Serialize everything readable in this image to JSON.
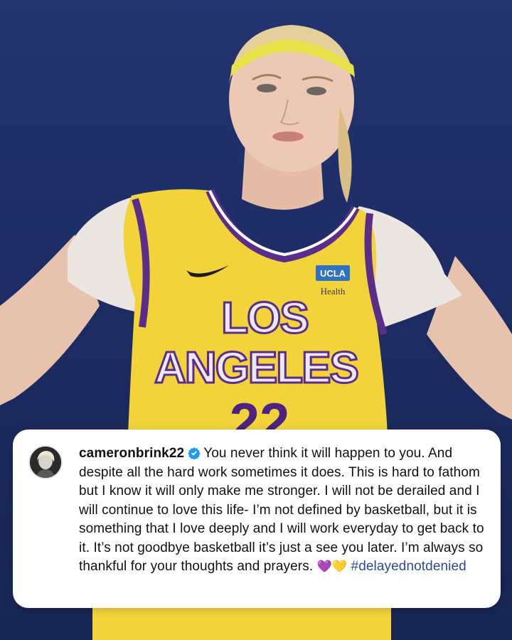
{
  "photo": {
    "jersey_text_line1": "LOS",
    "jersey_text_line2": "ANGELES",
    "jersey_number": "22",
    "sponsor_logo": "UCLA",
    "sponsor_text": "Health"
  },
  "post": {
    "username": "cameronbrink22",
    "verified_icon": "verified-badge-icon",
    "caption": "You never think it will happen to you. And despite all the hard work sometimes it does. This is hard to fathom but I know it will only make me stronger. I will not be derailed and I will continue to love this life- I’m not defined by basketball, but it is something that I love deeply and I will work everyday to get back to it. It’s not goodbye basketball it’s just a see you later. I’m always so thankful for your thoughts and prayers.",
    "emoji_1": "💜",
    "emoji_2": "💛",
    "hashtag": "#delayednotdenied"
  },
  "colors": {
    "background": "#1f2e66",
    "jersey": "#f2d33a",
    "jersey_trim": "#5b2d8a",
    "card": "#ffffff",
    "hashtag": "#2b4a9b",
    "verified": "#1d9bf0"
  }
}
